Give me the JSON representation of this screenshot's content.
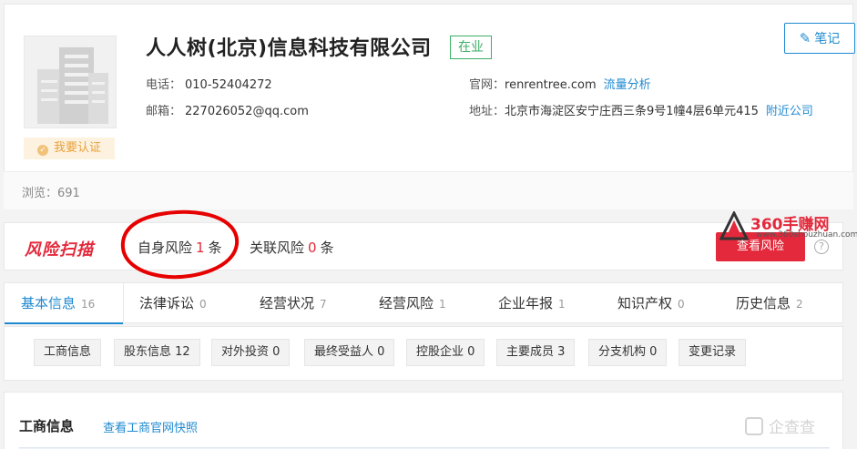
{
  "company": {
    "name": "人人树(北京)信息科技有限公司",
    "status": "在业",
    "verify_label": "我要认证",
    "phone_label": "电话：",
    "phone": "010-52404272",
    "email_label": "邮箱：",
    "email": "227026052@qq.com",
    "website_label": "官网：",
    "website": "renrentree.com",
    "traffic_link": "流量分析",
    "address_label": "地址：",
    "address": "北京市海淀区安宁庄西三条9号1幢4层6单元415",
    "nearby_link": "附近公司",
    "views": "浏览：691"
  },
  "note_button": {
    "label": "笔记",
    "icon": "pen-icon"
  },
  "risk": {
    "logo": "风险扫描",
    "self_label": "自身风险",
    "self_count": "1",
    "self_unit": "条",
    "related_label": "关联风险",
    "related_count": "0",
    "related_unit": "条",
    "button": "查看风险",
    "help": "?"
  },
  "watermark_top": {
    "title": "360手赚网",
    "url": "www.360shouzhuan.com"
  },
  "tabs": [
    {
      "label": "基本信息",
      "count": "16"
    },
    {
      "label": "法律诉讼",
      "count": "0"
    },
    {
      "label": "经营状况",
      "count": "7"
    },
    {
      "label": "经营风险",
      "count": "1"
    },
    {
      "label": "企业年报",
      "count": "1"
    },
    {
      "label": "知识产权",
      "count": "0"
    },
    {
      "label": "历史信息",
      "count": "2"
    }
  ],
  "subtabs": [
    "工商信息",
    "股东信息 12",
    "对外投资 0",
    "最终受益人 0",
    "控股企业 0",
    "主要成员 3",
    "分支机构 0",
    "变更记录"
  ],
  "section": {
    "title": "工商信息",
    "link": "查看工商官网快照"
  },
  "watermark_bottom": "企查查",
  "colors": {
    "accent": "#1f8ad1",
    "danger": "#e3293b",
    "success": "#3cae65"
  }
}
